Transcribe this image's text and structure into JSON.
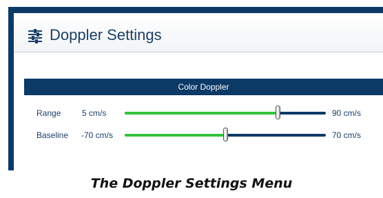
{
  "header": {
    "title": "Doppler Settings",
    "icon": "sliders-icon"
  },
  "section": {
    "title": "Color Doppler"
  },
  "settings": [
    {
      "label": "Range",
      "min_label": "5 cm/s",
      "max_label": "90 cm/s",
      "value_fraction": 0.76
    },
    {
      "label": "Baseline",
      "min_label": "-70 cm/s",
      "max_label": "70 cm/s",
      "value_fraction": 0.5
    }
  ],
  "caption": "The Doppler Settings Menu",
  "colors": {
    "frame": "#0b3a66",
    "accent_fill": "#34c33a",
    "text": "#1b3f66"
  }
}
